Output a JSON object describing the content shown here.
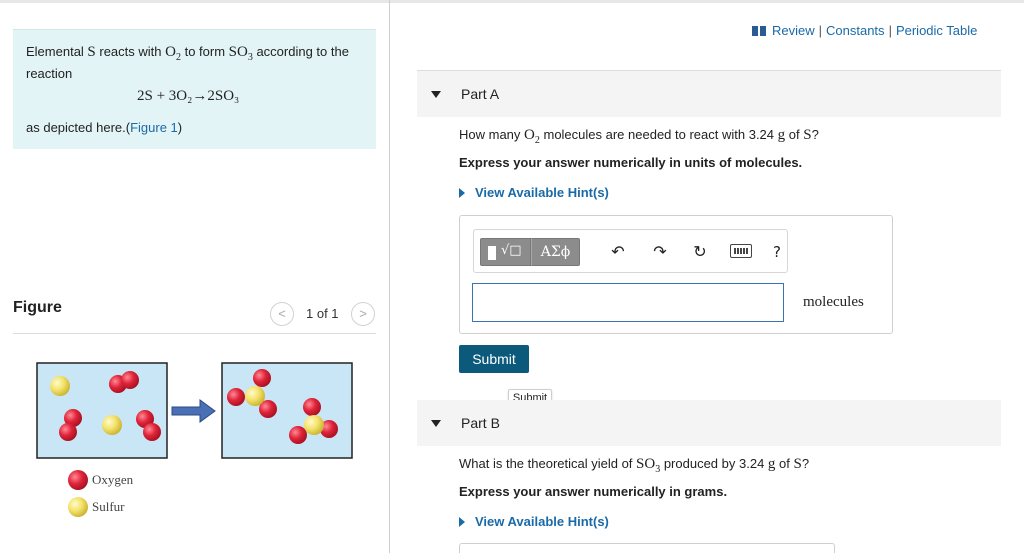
{
  "header_links": [
    "Review",
    "Constants",
    "Periodic Table"
  ],
  "header_separator": "|",
  "intro": {
    "text_before": "Elemental ",
    "s": "S",
    "text_mid": " reacts with ",
    "o2": "O",
    "o2_sub": "2",
    "text_mid2": " to form ",
    "so3": "SO",
    "so3_sub": "3",
    "text_after": " according to the reaction",
    "equation": "2S + 3O₂→2SO₃",
    "depicted_text": "as depicted here.(",
    "figure_link": "Figure 1",
    "depicted_close": ")"
  },
  "figure": {
    "title": "Figure",
    "pager_text": "1 of 1",
    "prev_symbol": "<",
    "next_symbol": ">",
    "legend": [
      {
        "label": "Oxygen",
        "color": "#e0243a"
      },
      {
        "label": "Sulfur",
        "color": "#f4e26a"
      }
    ],
    "arrow_color": "#4a6fb5",
    "box_background": "#c8e6f5"
  },
  "part_a": {
    "label": "Part A",
    "q_before": "How many ",
    "q_o2": "O",
    "q_o2_sub": "2",
    "q_mid": " molecules are needed to react with 3.24 ",
    "q_unit": "g",
    "q_mid2": " of ",
    "q_s": "S",
    "q_end": "?",
    "instruction": "Express your answer numerically in units of molecules.",
    "hint": "View Available Hint(s)",
    "toolbar": {
      "greek": "ΑΣϕ",
      "undo": "↶",
      "redo": "↷",
      "reset": "↻",
      "help": "?",
      "sqrt": "√□"
    },
    "unit": "molecules",
    "input_value": "",
    "submit": "Submit",
    "tooltip": "Submit"
  },
  "part_b": {
    "label": "Part B",
    "q_before": "What is the theoretical yield of ",
    "q_so3": "SO",
    "q_so3_sub": "3",
    "q_mid": " produced by 3.24 ",
    "q_unit": "g",
    "q_mid2": " of ",
    "q_s": "S",
    "q_end": "?",
    "instruction": "Express your answer numerically in grams.",
    "hint": "View Available Hint(s)"
  },
  "colors": {
    "accent_link": "#1a6aa8",
    "submit_bg": "#0b5a7c",
    "intro_bg": "#e3f4f6"
  }
}
